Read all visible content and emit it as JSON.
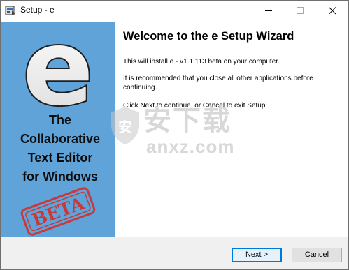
{
  "window": {
    "title": "Setup - e",
    "app_icon": "installer-icon",
    "controls": [
      "minimize-icon",
      "maximize-icon",
      "close-icon"
    ]
  },
  "sidebar": {
    "logo_letter": "e",
    "line1": "The",
    "line2": "Collaborative",
    "line3": "Text Editor",
    "line4": "for Windows",
    "stamp": "BETA",
    "background_color": "#5fa3d8",
    "stamp_color": "#c8393b"
  },
  "content": {
    "heading": "Welcome to the e Setup Wizard",
    "paragraph1": "This will install e - v1.1.113 beta on your computer.",
    "paragraph2": "It is recommended that you close all other applications before continuing.",
    "paragraph3": "Click Next to continue, or Cancel to exit Setup."
  },
  "watermark": {
    "cn": "安下载",
    "en": "anxz.com"
  },
  "footer": {
    "next_label": "Next >",
    "cancel_label": "Cancel",
    "accent_color": "#0078d7"
  }
}
